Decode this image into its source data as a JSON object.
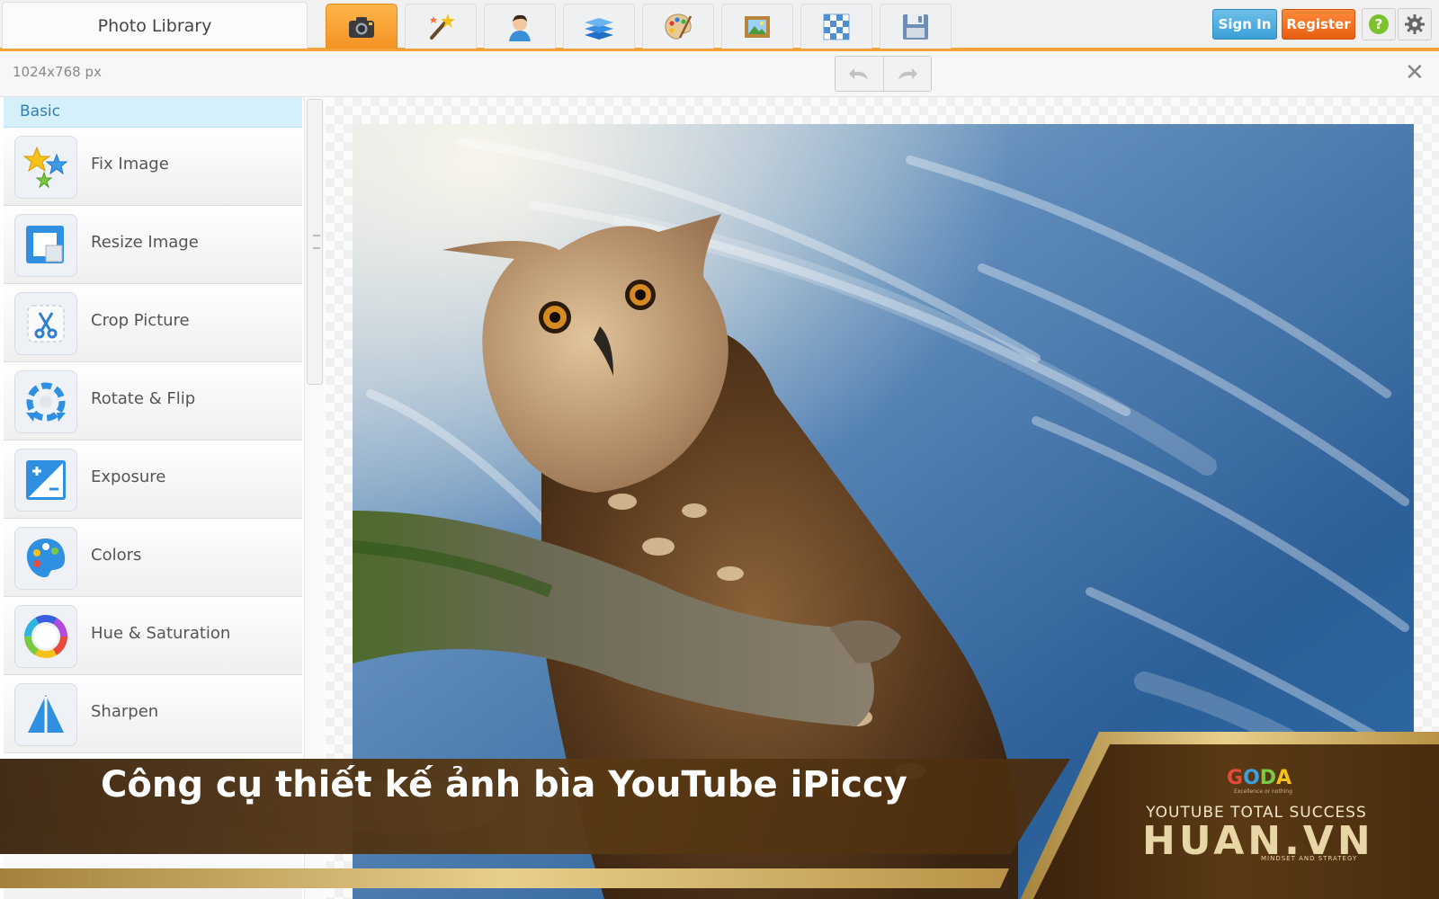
{
  "header": {
    "library_tab": "Photo Library",
    "tool_tabs": [
      {
        "icon": "camera-icon",
        "active": true
      },
      {
        "icon": "magic-wand-icon",
        "active": false
      },
      {
        "icon": "person-icon",
        "active": false
      },
      {
        "icon": "layers-icon",
        "active": false
      },
      {
        "icon": "palette-icon",
        "active": false
      },
      {
        "icon": "frame-icon",
        "active": false
      },
      {
        "icon": "checkerboard-icon",
        "active": false
      },
      {
        "icon": "save-disk-icon",
        "active": false
      }
    ],
    "sign_in": "Sign In",
    "register": "Register",
    "help_icon": "question-icon",
    "settings_icon": "gear-icon"
  },
  "subbar": {
    "dimensions": "1024x768 px",
    "close": "✕"
  },
  "sidebar": {
    "section": "Basic",
    "items": [
      {
        "label": "Fix Image",
        "icon": "stars-icon"
      },
      {
        "label": "Resize Image",
        "icon": "resize-icon"
      },
      {
        "label": "Crop Picture",
        "icon": "scissors-icon"
      },
      {
        "label": "Rotate & Flip",
        "icon": "rotate-icon"
      },
      {
        "label": "Exposure",
        "icon": "exposure-icon"
      },
      {
        "label": "Colors",
        "icon": "palette-icon"
      },
      {
        "label": "Hue & Saturation",
        "icon": "color-wheel-icon"
      },
      {
        "label": "Sharpen",
        "icon": "sharpen-icon"
      }
    ]
  },
  "banner": {
    "title": "Công cụ thiết kế ảnh bìa YouTube iPiccy",
    "logo_small": "GODA",
    "logo_small_sub": "Excellence or nothing",
    "logo_line": "YOUTUBE TOTAL SUCCESS",
    "logo_big": "HUAN.VN",
    "logo_tag": "MINDSET AND STRATEGY"
  },
  "colors": {
    "accent_orange": "#f5a23a",
    "sign_in_blue": "#3a9fd6",
    "register_orange": "#e85e10",
    "basic_header": "#d6f0fb",
    "banner_brown": "#4a2c0e",
    "banner_gold": "#c9a24e"
  }
}
